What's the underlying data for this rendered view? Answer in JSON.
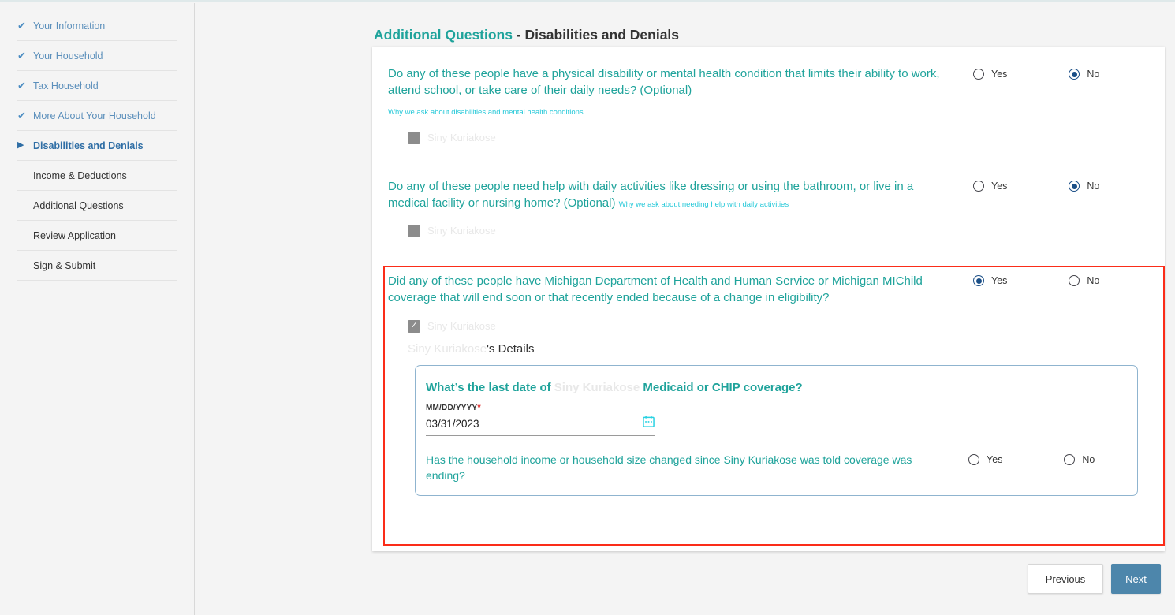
{
  "sidebar": {
    "items": [
      {
        "label": "Your Information",
        "state": "done",
        "icon": "check-icon"
      },
      {
        "label": "Your Household",
        "state": "done",
        "icon": "check-icon"
      },
      {
        "label": "Tax Household",
        "state": "done",
        "icon": "check-icon"
      },
      {
        "label": "More About Your Household",
        "state": "done",
        "icon": "check-icon"
      },
      {
        "label": "Disabilities and Denials",
        "state": "current",
        "icon": "triangle-right-icon"
      },
      {
        "label": "Income & Deductions",
        "state": "todo",
        "icon": ""
      },
      {
        "label": "Additional Questions",
        "state": "todo",
        "icon": ""
      },
      {
        "label": "Review Application",
        "state": "todo",
        "icon": ""
      },
      {
        "label": "Sign & Submit",
        "state": "todo",
        "icon": ""
      }
    ]
  },
  "header": {
    "title_accent": "Additional Questions",
    "title_rest": " - Disabilities and Denials"
  },
  "questions": [
    {
      "text": "Do any of these people have a physical disability or mental health condition that limits their ability to work, attend school, or take care of their daily needs? (Optional)",
      "why_link": "Why we ask about disabilities and mental health conditions",
      "person": "Siny Kuriakose",
      "checkbox_checked": false,
      "yes_label": "Yes",
      "no_label": "No",
      "selected": "No"
    },
    {
      "text": "Do any of these people need help with daily activities like dressing or using the bathroom, or live in a medical facility or nursing home? (Optional)",
      "why_link": "Why we ask about needing help with daily activities",
      "person": "Siny Kuriakose",
      "checkbox_checked": false,
      "yes_label": "Yes",
      "no_label": "No",
      "selected": "No"
    },
    {
      "text": "Did any of these people have Michigan Department of Health and Human Service or Michigan MIChild coverage that will end soon or that recently ended because of a change in eligibility?",
      "why_link": "",
      "person": "Siny Kuriakose",
      "checkbox_checked": true,
      "yes_label": "Yes",
      "no_label": "No",
      "selected": "Yes"
    }
  ],
  "details": {
    "heading_name": "Siny Kuriakose",
    "heading_suffix": "'s Details",
    "date_question_prefix": "What’s the last date of ",
    "date_question_name": "Siny Kuriakose",
    "date_question_suffix": " Medicaid or CHIP coverage?",
    "date_label": "MM/DD/YYYY",
    "date_required_mark": "*",
    "date_value": "03/31/2023",
    "date_placeholder": "MM/DD/YYYY",
    "calendar_icon": "calendar-icon",
    "sub_question": "Has the household income or household size changed since Siny Kuriakose was told coverage was ending?",
    "sub_yes_label": "Yes",
    "sub_no_label": "No",
    "sub_selected": ""
  },
  "footer": {
    "previous_label": "Previous",
    "next_label": "Next"
  },
  "colors": {
    "accent_teal": "#1fa39b",
    "link_cyan": "#24c8d8",
    "nav_blue": "#4a7fab",
    "radio_selected": "#1b4f87",
    "highlight_red": "#fb2d19",
    "next_button": "#4d86ab"
  }
}
